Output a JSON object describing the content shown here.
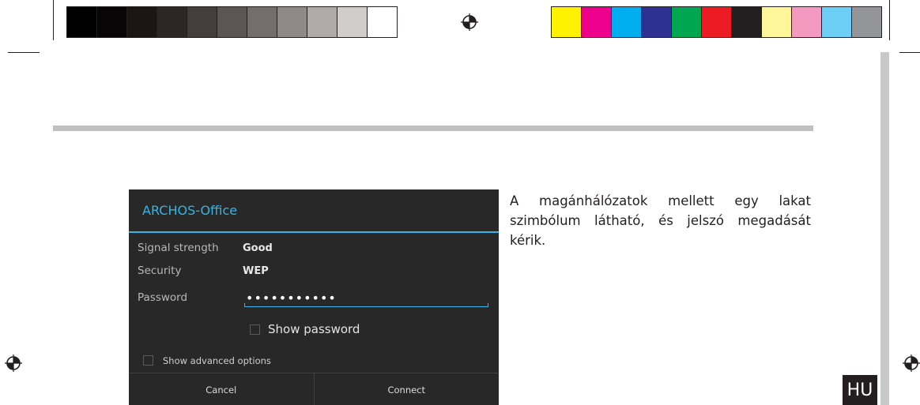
{
  "print_marks": {
    "grayscale_swatches": [
      "#000000",
      "#070505",
      "#1d1414",
      "#2e2626",
      "#433d3b",
      "#5c5553",
      "#756d6b",
      "#908987",
      "#b0aaa9",
      "#d0cdcd",
      "#ffffff"
    ],
    "color_swatches": [
      "#fff200",
      "#ec008c",
      "#00aeef",
      "#2e3192",
      "#00a651",
      "#ed1c24",
      "#231f20",
      "#fff799",
      "#f49ac1",
      "#6dcff6",
      "#939598"
    ],
    "registration_icon": "registration-target-icon"
  },
  "dialog": {
    "title": "ARCHOS-Office",
    "signal_strength_label": "Signal strength",
    "signal_strength_value": "Good",
    "security_label": "Security",
    "security_value": "WEP",
    "password_label": "Password",
    "password_value": "•••••••••••",
    "show_password_label": "Show password",
    "show_advanced_label": "Show advanced options",
    "cancel_label": "Cancel",
    "connect_label": "Connect",
    "accent_color": "#33b5e5"
  },
  "body_text": "A magánhálózatok mellett egy lakat szimbólum látható, és jelszó megadását kérik.",
  "language_tab": "HU"
}
